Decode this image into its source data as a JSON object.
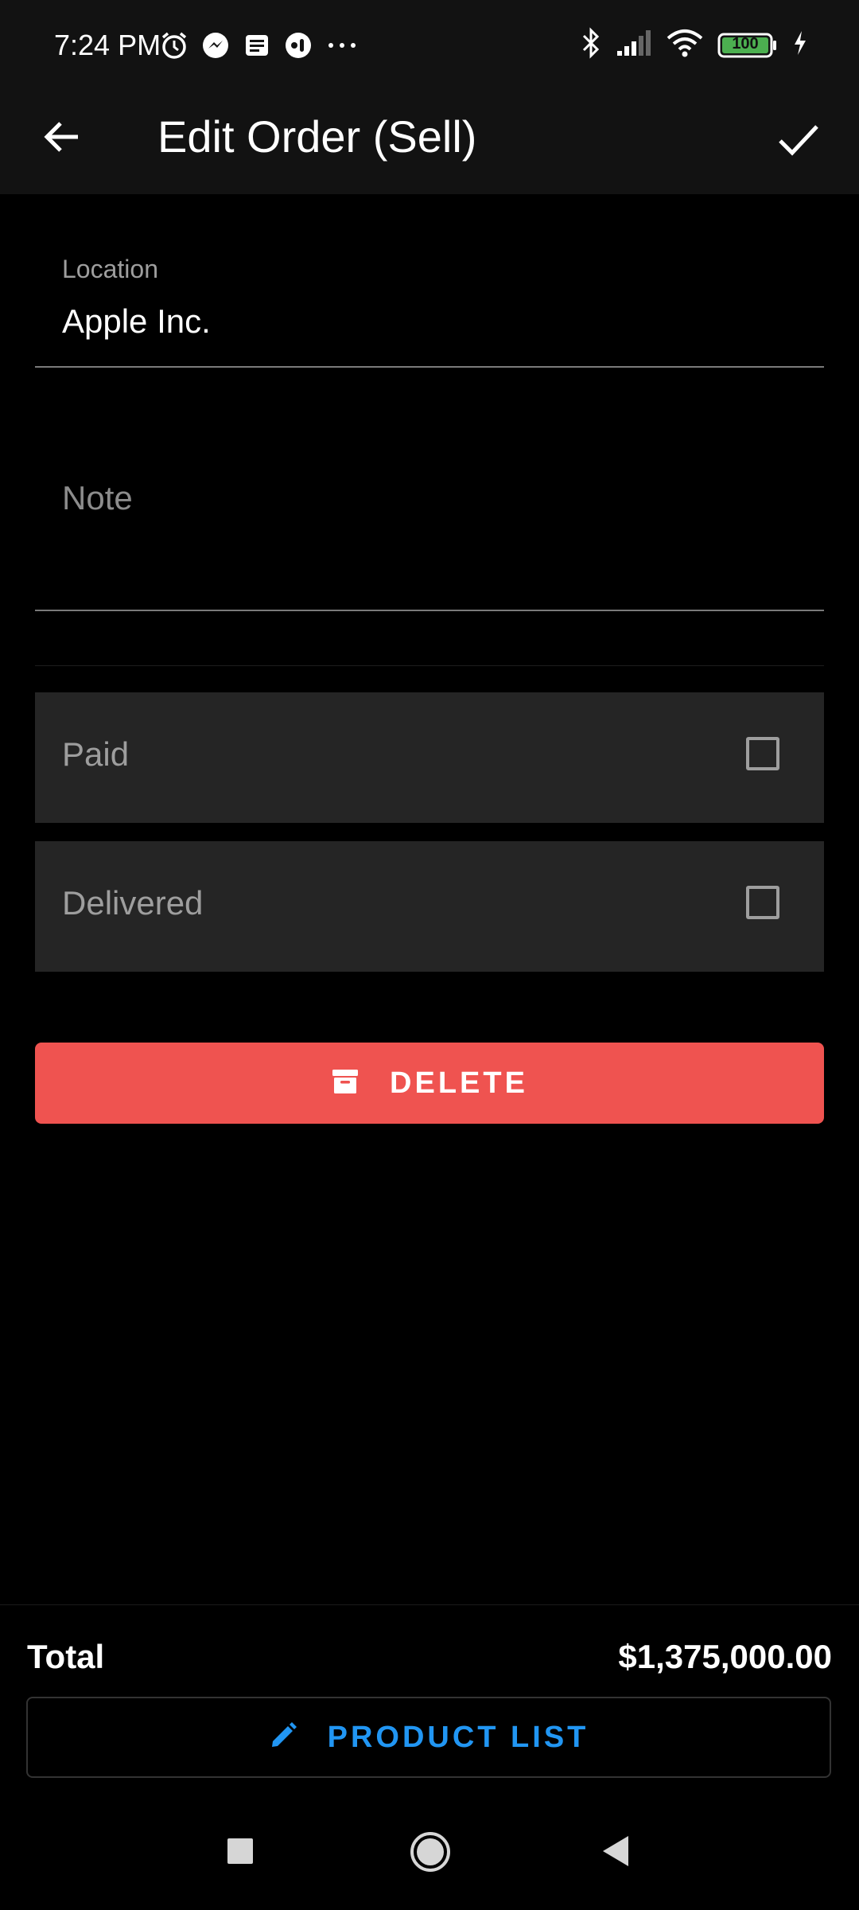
{
  "status_bar": {
    "time": "7:24 PM",
    "left_icons": [
      "alarm-icon",
      "messenger-icon",
      "notes-icon",
      "assistant-icon",
      "more-dots-icon"
    ],
    "right_icons": [
      "bluetooth-icon",
      "signal-icon",
      "wifi-icon",
      "battery-icon",
      "charging-icon"
    ],
    "battery_level": "100"
  },
  "app_bar": {
    "title": "Edit Order (Sell)",
    "back_icon": "arrow-back-icon",
    "confirm_icon": "check-icon"
  },
  "form": {
    "location": {
      "label": "Location",
      "value": "Apple Inc."
    },
    "note": {
      "placeholder": "Note"
    },
    "paid": {
      "label": "Paid",
      "checked": false
    },
    "delivered": {
      "label": "Delivered",
      "checked": false
    }
  },
  "delete_button": {
    "label": "DELETE",
    "icon": "archive-icon",
    "color": "#ef5350"
  },
  "footer": {
    "total_label": "Total",
    "total_value": "$1,375,000.00",
    "product_list_label": "PRODUCT LIST",
    "product_list_icon": "pencil-icon",
    "accent_color": "#2196f3"
  },
  "nav_bar": {
    "buttons": [
      "recents-square-icon",
      "home-circle-icon",
      "back-triangle-icon"
    ]
  }
}
